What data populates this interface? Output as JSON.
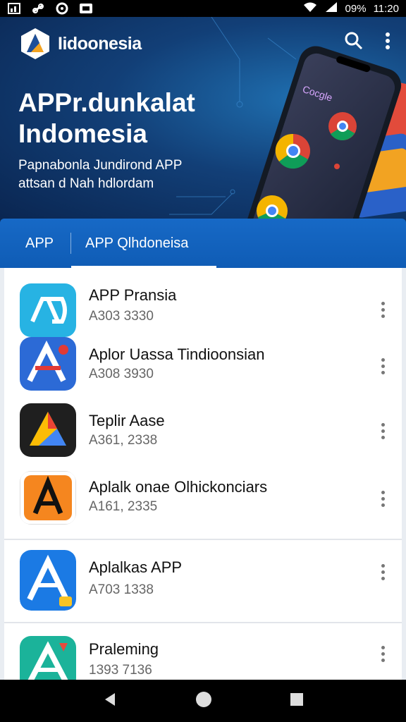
{
  "status_bar": {
    "battery": "09%",
    "time": "11:20",
    "left_icons": [
      "gallery-icon",
      "link-icon",
      "circle-app-icon",
      "cast-icon"
    ],
    "right_icons": [
      "wifi-icon",
      "signal-icon"
    ]
  },
  "header": {
    "brand": "Iidoonesia",
    "title": "APPr.dunkalat Indomesia",
    "subtitle": "Papnabonla Jundirond APP attsan d Nah hdlordam",
    "actions": [
      "search-icon",
      "more-vert-icon"
    ],
    "phone_brand": "Cocgle"
  },
  "tabs": [
    {
      "label": "APP"
    },
    {
      "label": "APP Qlhdoneisa",
      "active": true
    }
  ],
  "apps": [
    {
      "name": "APP Pransia",
      "meta": "A303 3330"
    },
    {
      "name": "Aplor Uassa Tindioonsian",
      "meta": "A308 3930"
    },
    {
      "name": "Teplir Aase",
      "meta": "A361, 2338"
    },
    {
      "name": "Aplalk onae Olhickonciars",
      "meta": "A161, 2335"
    },
    {
      "name": "Aplalkas APP",
      "meta": "A703 1338"
    },
    {
      "name": "Praleming",
      "meta": "1393 7136"
    }
  ],
  "nav": [
    "back-icon",
    "home-icon",
    "recents-icon"
  ],
  "colors": {
    "accent": "#1769c6",
    "hero_dark": "#0a2550",
    "hero_light": "#1f6fb0"
  }
}
